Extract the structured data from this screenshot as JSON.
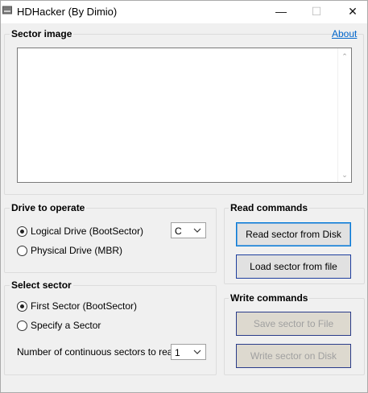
{
  "window": {
    "title": "HDHacker (By Dimio)",
    "minimize_glyph": "—",
    "maximize_glyph": "☐",
    "close_glyph": "✕",
    "icon": "drive-icon"
  },
  "sector_image": {
    "label": "Sector image",
    "about_link": "About",
    "content": "",
    "scroll_up_glyph": "⌃",
    "scroll_down_glyph": "⌄"
  },
  "drive": {
    "label": "Drive to operate",
    "logical_label": "Logical Drive (BootSector)",
    "physical_label": "Physical Drive (MBR)",
    "selected": "logical",
    "drive_letter": "C"
  },
  "read_commands": {
    "label": "Read commands",
    "read_button": "Read sector from Disk",
    "load_button": "Load sector from file"
  },
  "select_sector": {
    "label": "Select sector",
    "first_label": "First Sector (BootSector)",
    "specify_label": "Specify a Sector",
    "selected": "first",
    "count_label": "Number of continuous sectors to read:",
    "count_value": "1"
  },
  "write_commands": {
    "label": "Write commands",
    "save_button": "Save sector to File",
    "write_button": "Write sector on Disk"
  }
}
